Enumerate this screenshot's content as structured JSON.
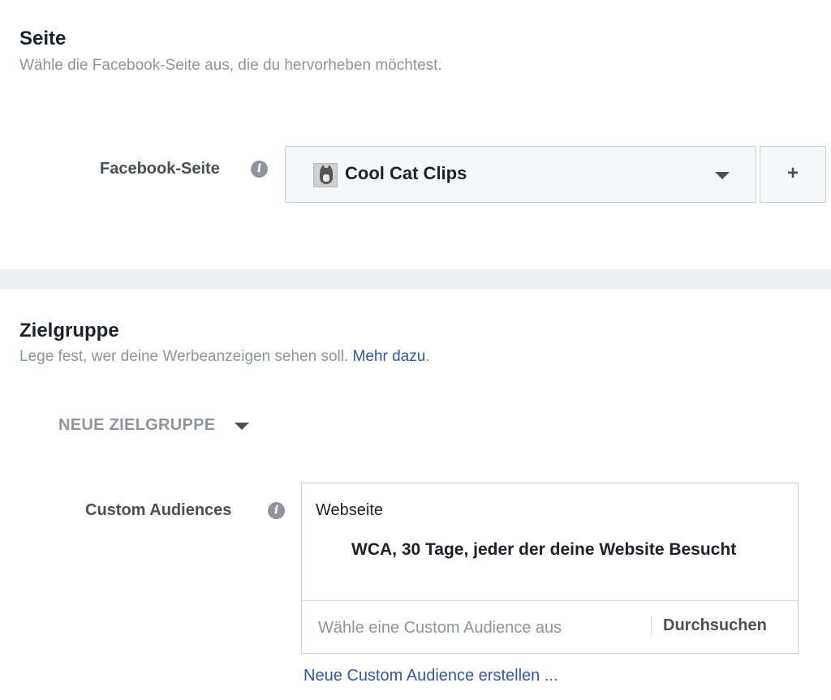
{
  "page_section": {
    "title": "Seite",
    "description": "Wähle die Facebook-Seite aus, die du hervorheben möchtest.",
    "field_label": "Facebook-Seite",
    "selected_page": "Cool Cat Clips",
    "add_button": "+"
  },
  "audience_section": {
    "title": "Zielgruppe",
    "description": "Lege fest, wer deine Werbeanzeigen sehen soll.",
    "learn_more": "Mehr dazu",
    "trailing_period": ".",
    "new_audience_label": "NEUE ZIELGRUPPE",
    "custom_audiences": {
      "label": "Custom Audiences",
      "group_label": "Webseite",
      "selected": "WCA, 30 Tage, jeder der deine Website Besucht",
      "search_placeholder": "Wähle eine Custom Audience aus",
      "browse_button": "Durchsuchen",
      "create_link": "Neue Custom Audience erstellen ..."
    }
  },
  "colors": {
    "link": "#365899",
    "muted_text": "#90949c",
    "divider_band": "#eceef1"
  },
  "icons": [
    "info-icon",
    "chevron-down-icon",
    "plus-icon",
    "page-avatar"
  ]
}
